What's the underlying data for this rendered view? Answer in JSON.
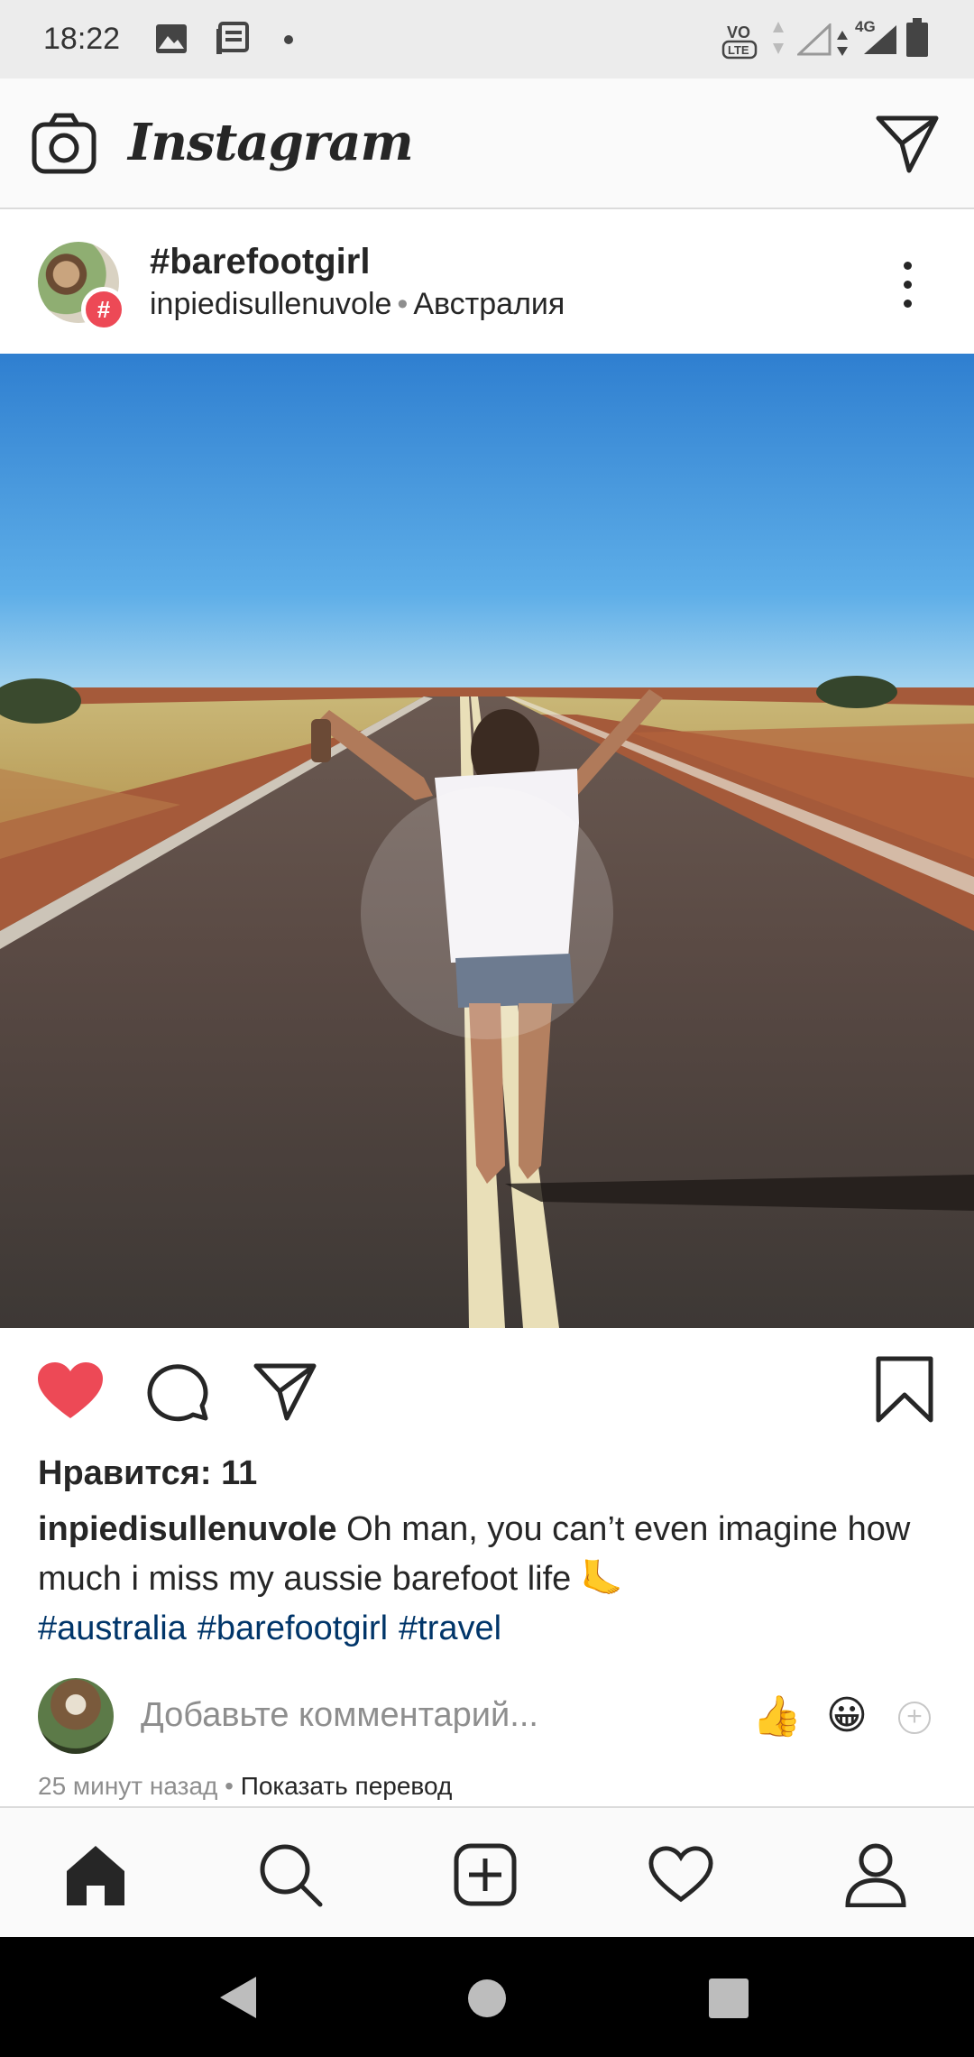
{
  "status_bar": {
    "time": "18:22",
    "network": "4G",
    "volte": "VoLTE",
    "icons": [
      "image-icon",
      "news-icon",
      "dot-icon",
      "volte-icon",
      "signal-icon",
      "battery-icon"
    ]
  },
  "app_header": {
    "brand": "Instagram",
    "camera_icon": "camera-icon",
    "direct_icon": "paper-plane-icon"
  },
  "post": {
    "title": "#barefootgirl",
    "username": "inpiedisullenuvole",
    "location": "Австралия",
    "badge": "#",
    "photo_alt": "Woman standing barefoot on an outback road with arms raised",
    "likes": "Нравится: 11",
    "caption_user": "inpiedisullenuvole",
    "caption_text": "Oh man, you can’t even imagine how much i miss my aussie barefoot life 🦶",
    "hashtags": [
      "#australia",
      "#barefootgirl",
      "#travel"
    ],
    "liked": true,
    "like_color": "#ed4956"
  },
  "comment": {
    "placeholder": "Добавьте комментарий...",
    "emoji_1": "👍",
    "emoji_2": "😀",
    "plus": "+"
  },
  "meta": {
    "time_ago": "25 минут назад",
    "translate": "Показать перевод"
  },
  "bottom_nav": {
    "items": [
      "home-icon",
      "search-icon",
      "add-post-icon",
      "activity-heart-icon",
      "profile-icon"
    ]
  },
  "system_nav": {
    "items": [
      "back-icon",
      "home-circle-icon",
      "recents-icon"
    ]
  }
}
